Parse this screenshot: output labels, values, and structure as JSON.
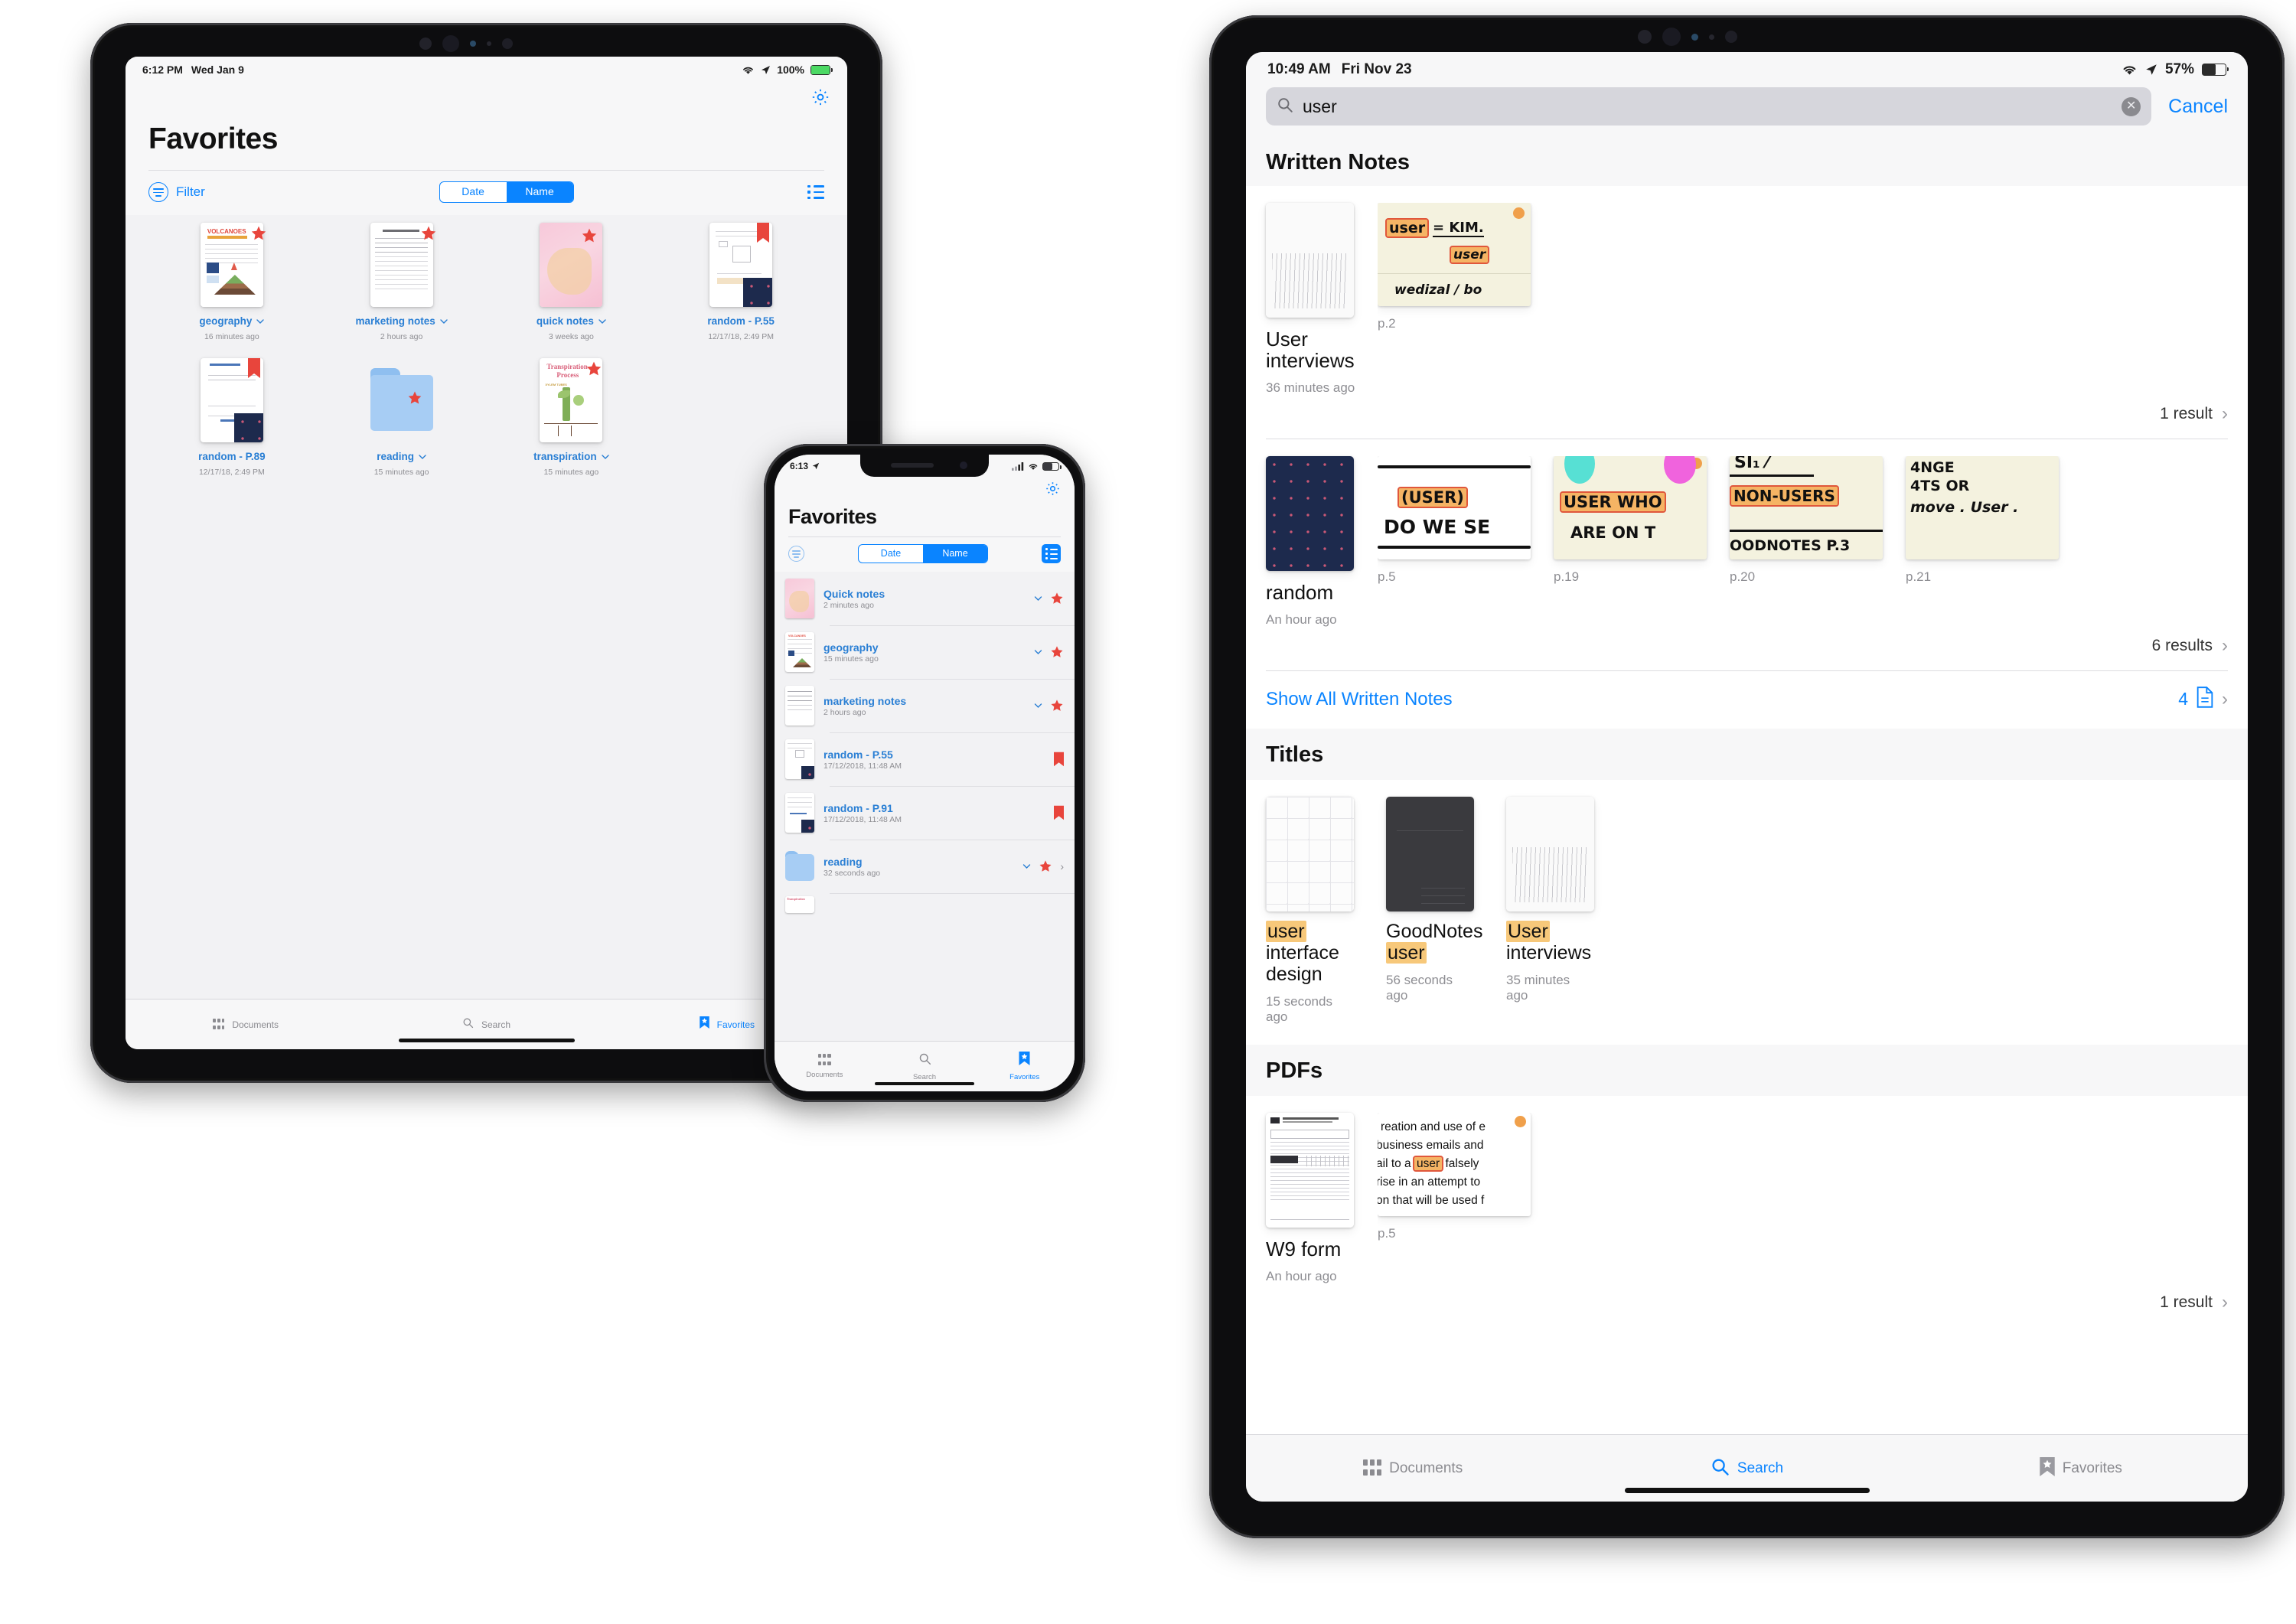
{
  "app": {
    "name": "GoodNotes"
  },
  "ipad_left": {
    "statusbar": {
      "time": "6:12 PM",
      "date": "Wed Jan 9",
      "wifi_icon": "wifi-icon",
      "location_icon": "location-arrow-icon",
      "battery_text": "100%",
      "battery_icon": "battery-charging-icon",
      "battery_color": "#4cd964"
    },
    "settings_icon": "gear-icon",
    "title": "Favorites",
    "toolbar": {
      "filter_label": "Filter",
      "filter_icon": "filter-icon",
      "segments": [
        {
          "label": "Date",
          "selected": false
        },
        {
          "label": "Name",
          "selected": true
        }
      ],
      "listview_icon": "list-view-icon"
    },
    "accent": "#0a84ff",
    "documents": [
      {
        "name": "geography",
        "date": "16 minutes ago",
        "badge": "star",
        "chevron": true,
        "art": "volcanoes"
      },
      {
        "name": "marketing notes",
        "date": "2 hours ago",
        "badge": "star",
        "chevron": true,
        "art": "ruled-notes"
      },
      {
        "name": "quick notes",
        "date": "3 weeks ago",
        "badge": "star",
        "chevron": true,
        "art": "pink-cover"
      },
      {
        "name": "random - P.55",
        "date": "12/17/18, 2:49 PM",
        "badge": "bookmark",
        "chevron": false,
        "art": "sketch-navy"
      },
      {
        "name": "random - P.89",
        "date": "12/17/18, 2:49 PM",
        "badge": "bookmark",
        "chevron": false,
        "art": "sketch-navy-2"
      },
      {
        "name": "reading",
        "date": "15 minutes ago",
        "badge": "star",
        "chevron": true,
        "art": "folder"
      },
      {
        "name": "transpiration",
        "date": "15 minutes ago",
        "badge": "star",
        "chevron": true,
        "art": "transpiration"
      }
    ],
    "tabs": [
      {
        "label": "Documents",
        "icon": "grid-icon",
        "active": false
      },
      {
        "label": "Search",
        "icon": "search-icon",
        "active": false
      },
      {
        "label": "Favorites",
        "icon": "bookmark-star-icon",
        "active": true
      }
    ]
  },
  "iphone": {
    "statusbar": {
      "time": "6:13",
      "location_icon": "location-arrow-icon",
      "signal_icon": "cellular-bars-icon",
      "wifi_icon": "wifi-icon",
      "battery_icon": "battery-icon"
    },
    "settings_icon": "gear-icon",
    "title": "Favorites",
    "toolbar": {
      "filter_icon": "filter-icon",
      "segments": [
        {
          "label": "Date",
          "selected": false
        },
        {
          "label": "Name",
          "selected": true
        }
      ],
      "listview_icon": "list-view-icon"
    },
    "rows": [
      {
        "name": "Quick notes",
        "date": "2 minutes ago",
        "badge": "star",
        "chevron": true,
        "disclosure": false,
        "art": "pink-cover"
      },
      {
        "name": "geography",
        "date": "15 minutes ago",
        "badge": "star",
        "chevron": true,
        "disclosure": false,
        "art": "volcanoes"
      },
      {
        "name": "marketing notes",
        "date": "2 hours ago",
        "badge": "star",
        "chevron": true,
        "disclosure": false,
        "art": "ruled-notes"
      },
      {
        "name": "random - P.55",
        "date": "17/12/2018, 11:48 AM",
        "badge": "bookmark",
        "chevron": false,
        "disclosure": false,
        "art": "sketch-navy"
      },
      {
        "name": "random - P.91",
        "date": "17/12/2018, 11:48 AM",
        "badge": "bookmark",
        "chevron": false,
        "disclosure": false,
        "art": "sketch-navy-2"
      },
      {
        "name": "reading",
        "date": "32 seconds ago",
        "badge": "star",
        "chevron": true,
        "disclosure": true,
        "art": "folder"
      }
    ],
    "tabs": [
      {
        "label": "Documents",
        "icon": "grid-icon",
        "active": false
      },
      {
        "label": "Search",
        "icon": "search-icon",
        "active": false
      },
      {
        "label": "Favorites",
        "icon": "bookmark-star-icon",
        "active": true
      }
    ]
  },
  "ipad_right": {
    "statusbar": {
      "time": "10:49 AM",
      "date": "Fri Nov 23",
      "wifi_icon": "wifi-icon",
      "location_icon": "location-arrow-icon",
      "battery_text": "57%",
      "battery_icon": "battery-icon"
    },
    "search": {
      "value": "user",
      "placeholder": "Search",
      "search_icon": "search-icon",
      "clear_icon": "clear-circle-icon",
      "cancel_label": "Cancel"
    },
    "sections": [
      {
        "title": "Written Notes",
        "results": [
          {
            "doc_title": "User interviews",
            "doc_date": "36 minutes ago",
            "cover_art": "dotgrid-cover",
            "snippets": [
              {
                "page": "p.2",
                "art": "note-user-kim",
                "dot": true,
                "lines": [
                  "user",
                  "= KIM.",
                  "user",
                  "wedizal / bo"
                ]
              }
            ],
            "count_label": "1 result"
          },
          {
            "doc_title": "random",
            "doc_date": "An hour ago",
            "cover_art": "navy-cover",
            "snippets": [
              {
                "page": "p.5",
                "art": "note-cuser",
                "dot": false,
                "lines": [
                  "(USER)",
                  "DO WE SE"
                ]
              },
              {
                "page": "p.19",
                "art": "note-user-who",
                "dot": true,
                "lines": [
                  "USER WHO",
                  "ARE ON T"
                ]
              },
              {
                "page": "p.20",
                "art": "note-non-users",
                "dot": false,
                "lines": [
                  "NON-USERS",
                  "OODNOTES P.3"
                ]
              },
              {
                "page": "p.21",
                "art": "note-move-user",
                "dot": false,
                "lines": [
                  "4NGE",
                  "4TS OR",
                  "move . User ."
                ]
              }
            ],
            "count_label": "6 results"
          }
        ],
        "footer_link": "Show All Written Notes",
        "footer_count": "4",
        "footer_icon": "page-icon"
      },
      {
        "title": "Titles",
        "titles": [
          {
            "name_parts": [
              {
                "t": "user",
                "hl": true
              },
              {
                "t": " interface design",
                "hl": false
              }
            ],
            "date": "15 seconds ago",
            "cover_art": "graph-cover"
          },
          {
            "name_parts": [
              {
                "t": "GoodNotes ",
                "hl": false
              },
              {
                "t": "user",
                "hl": true
              }
            ],
            "date": "56 seconds ago",
            "cover_art": "dark-cover"
          },
          {
            "name_parts": [
              {
                "t": "User",
                "hl": true
              },
              {
                "t": " interviews",
                "hl": false
              }
            ],
            "date": "35 minutes ago",
            "cover_art": "dotgrid-cover"
          }
        ]
      },
      {
        "title": "PDFs",
        "results": [
          {
            "doc_title": "W9 form",
            "doc_date": "An hour ago",
            "cover_art": "form-cover",
            "snippets": [
              {
                "page": "p.5",
                "art": "pdf-text",
                "dot": true,
                "lines": [
                  "reation and use of e",
                  "business emails and",
                  "ail to a [user] falsely",
                  "rise in an attempt to",
                  "on that will be used f"
                ]
              }
            ],
            "count_label": "1 result"
          }
        ]
      }
    ],
    "tabs": [
      {
        "label": "Documents",
        "icon": "grid-icon",
        "active": false
      },
      {
        "label": "Search",
        "icon": "search-icon",
        "active": true
      },
      {
        "label": "Favorites",
        "icon": "bookmark-star-icon",
        "active": false
      }
    ]
  },
  "colors": {
    "accent": "#0a84ff",
    "link": "#2a7fd4",
    "star": "#e8453c",
    "highlight": "#f7c87a",
    "muted": "#8e8e93"
  }
}
